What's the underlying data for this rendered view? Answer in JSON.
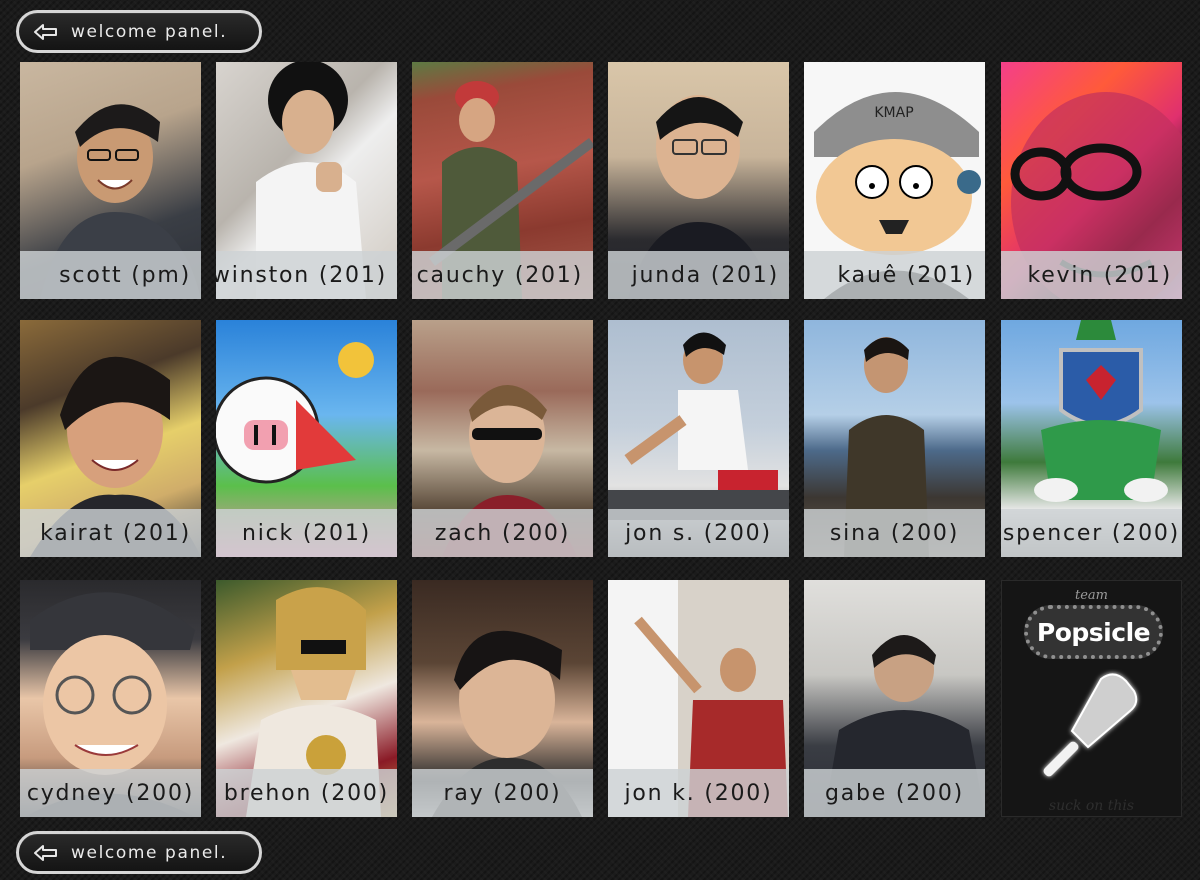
{
  "nav": {
    "top_label": "welcome panel.",
    "bottom_label": "welcome panel."
  },
  "team": [
    {
      "name": "scott (pm)",
      "icon": "scott-photo"
    },
    {
      "name": "winston (201)",
      "icon": "winston-photo"
    },
    {
      "name": "cauchy (201)",
      "icon": "cauchy-photo"
    },
    {
      "name": "junda (201)",
      "icon": "junda-photo"
    },
    {
      "name": "kauê (201)",
      "icon": "kaue-photo"
    },
    {
      "name": "kevin (201)",
      "icon": "kevin-photo"
    },
    {
      "name": "kairat (201)",
      "icon": "kairat-photo"
    },
    {
      "name": "nick (201)",
      "icon": "nick-photo"
    },
    {
      "name": "zach (200)",
      "icon": "zach-photo"
    },
    {
      "name": "jon s. (200)",
      "icon": "jons-photo"
    },
    {
      "name": "sina (200)",
      "icon": "sina-photo"
    },
    {
      "name": "spencer (200)",
      "icon": "spencer-photo"
    },
    {
      "name": "cydney (200)",
      "icon": "cydney-photo"
    },
    {
      "name": "brehon (200)",
      "icon": "brehon-photo"
    },
    {
      "name": "ray (200)",
      "icon": "ray-photo"
    },
    {
      "name": "jon k. (200)",
      "icon": "jonk-photo"
    },
    {
      "name": "gabe (200)",
      "icon": "gabe-photo"
    }
  ],
  "logo": {
    "team_label": "team",
    "brand": "Popsicle",
    "tagline": "suck on this"
  },
  "kaue_cap_text": "KMAP"
}
